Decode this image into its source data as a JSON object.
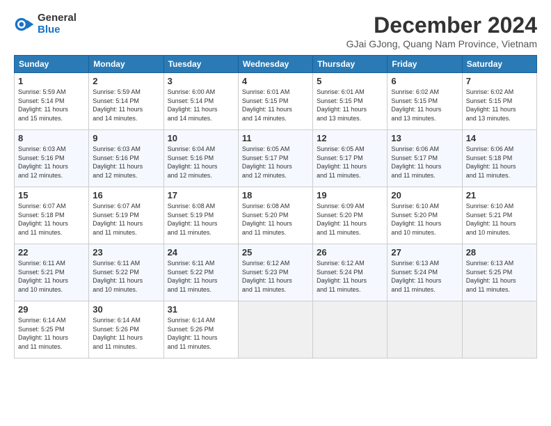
{
  "logo": {
    "general": "General",
    "blue": "Blue"
  },
  "title": "December 2024",
  "location": "GJai GJong, Quang Nam Province, Vietnam",
  "weekdays": [
    "Sunday",
    "Monday",
    "Tuesday",
    "Wednesday",
    "Thursday",
    "Friday",
    "Saturday"
  ],
  "weeks": [
    [
      {
        "day": "1",
        "sunrise": "5:59 AM",
        "sunset": "5:14 PM",
        "daylight": "11 hours and 15 minutes."
      },
      {
        "day": "2",
        "sunrise": "5:59 AM",
        "sunset": "5:14 PM",
        "daylight": "11 hours and 14 minutes."
      },
      {
        "day": "3",
        "sunrise": "6:00 AM",
        "sunset": "5:14 PM",
        "daylight": "11 hours and 14 minutes."
      },
      {
        "day": "4",
        "sunrise": "6:01 AM",
        "sunset": "5:15 PM",
        "daylight": "11 hours and 14 minutes."
      },
      {
        "day": "5",
        "sunrise": "6:01 AM",
        "sunset": "5:15 PM",
        "daylight": "11 hours and 13 minutes."
      },
      {
        "day": "6",
        "sunrise": "6:02 AM",
        "sunset": "5:15 PM",
        "daylight": "11 hours and 13 minutes."
      },
      {
        "day": "7",
        "sunrise": "6:02 AM",
        "sunset": "5:15 PM",
        "daylight": "11 hours and 13 minutes."
      }
    ],
    [
      {
        "day": "8",
        "sunrise": "6:03 AM",
        "sunset": "5:16 PM",
        "daylight": "11 hours and 12 minutes."
      },
      {
        "day": "9",
        "sunrise": "6:03 AM",
        "sunset": "5:16 PM",
        "daylight": "11 hours and 12 minutes."
      },
      {
        "day": "10",
        "sunrise": "6:04 AM",
        "sunset": "5:16 PM",
        "daylight": "11 hours and 12 minutes."
      },
      {
        "day": "11",
        "sunrise": "6:05 AM",
        "sunset": "5:17 PM",
        "daylight": "11 hours and 12 minutes."
      },
      {
        "day": "12",
        "sunrise": "6:05 AM",
        "sunset": "5:17 PM",
        "daylight": "11 hours and 11 minutes."
      },
      {
        "day": "13",
        "sunrise": "6:06 AM",
        "sunset": "5:17 PM",
        "daylight": "11 hours and 11 minutes."
      },
      {
        "day": "14",
        "sunrise": "6:06 AM",
        "sunset": "5:18 PM",
        "daylight": "11 hours and 11 minutes."
      }
    ],
    [
      {
        "day": "15",
        "sunrise": "6:07 AM",
        "sunset": "5:18 PM",
        "daylight": "11 hours and 11 minutes."
      },
      {
        "day": "16",
        "sunrise": "6:07 AM",
        "sunset": "5:19 PM",
        "daylight": "11 hours and 11 minutes."
      },
      {
        "day": "17",
        "sunrise": "6:08 AM",
        "sunset": "5:19 PM",
        "daylight": "11 hours and 11 minutes."
      },
      {
        "day": "18",
        "sunrise": "6:08 AM",
        "sunset": "5:20 PM",
        "daylight": "11 hours and 11 minutes."
      },
      {
        "day": "19",
        "sunrise": "6:09 AM",
        "sunset": "5:20 PM",
        "daylight": "11 hours and 11 minutes."
      },
      {
        "day": "20",
        "sunrise": "6:10 AM",
        "sunset": "5:20 PM",
        "daylight": "11 hours and 10 minutes."
      },
      {
        "day": "21",
        "sunrise": "6:10 AM",
        "sunset": "5:21 PM",
        "daylight": "11 hours and 10 minutes."
      }
    ],
    [
      {
        "day": "22",
        "sunrise": "6:11 AM",
        "sunset": "5:21 PM",
        "daylight": "11 hours and 10 minutes."
      },
      {
        "day": "23",
        "sunrise": "6:11 AM",
        "sunset": "5:22 PM",
        "daylight": "11 hours and 10 minutes."
      },
      {
        "day": "24",
        "sunrise": "6:11 AM",
        "sunset": "5:22 PM",
        "daylight": "11 hours and 11 minutes."
      },
      {
        "day": "25",
        "sunrise": "6:12 AM",
        "sunset": "5:23 PM",
        "daylight": "11 hours and 11 minutes."
      },
      {
        "day": "26",
        "sunrise": "6:12 AM",
        "sunset": "5:24 PM",
        "daylight": "11 hours and 11 minutes."
      },
      {
        "day": "27",
        "sunrise": "6:13 AM",
        "sunset": "5:24 PM",
        "daylight": "11 hours and 11 minutes."
      },
      {
        "day": "28",
        "sunrise": "6:13 AM",
        "sunset": "5:25 PM",
        "daylight": "11 hours and 11 minutes."
      }
    ],
    [
      {
        "day": "29",
        "sunrise": "6:14 AM",
        "sunset": "5:25 PM",
        "daylight": "11 hours and 11 minutes."
      },
      {
        "day": "30",
        "sunrise": "6:14 AM",
        "sunset": "5:26 PM",
        "daylight": "11 hours and 11 minutes."
      },
      {
        "day": "31",
        "sunrise": "6:14 AM",
        "sunset": "5:26 PM",
        "daylight": "11 hours and 11 minutes."
      },
      null,
      null,
      null,
      null
    ]
  ],
  "labels": {
    "sunrise": "Sunrise:",
    "sunset": "Sunset:",
    "daylight": "Daylight:"
  }
}
